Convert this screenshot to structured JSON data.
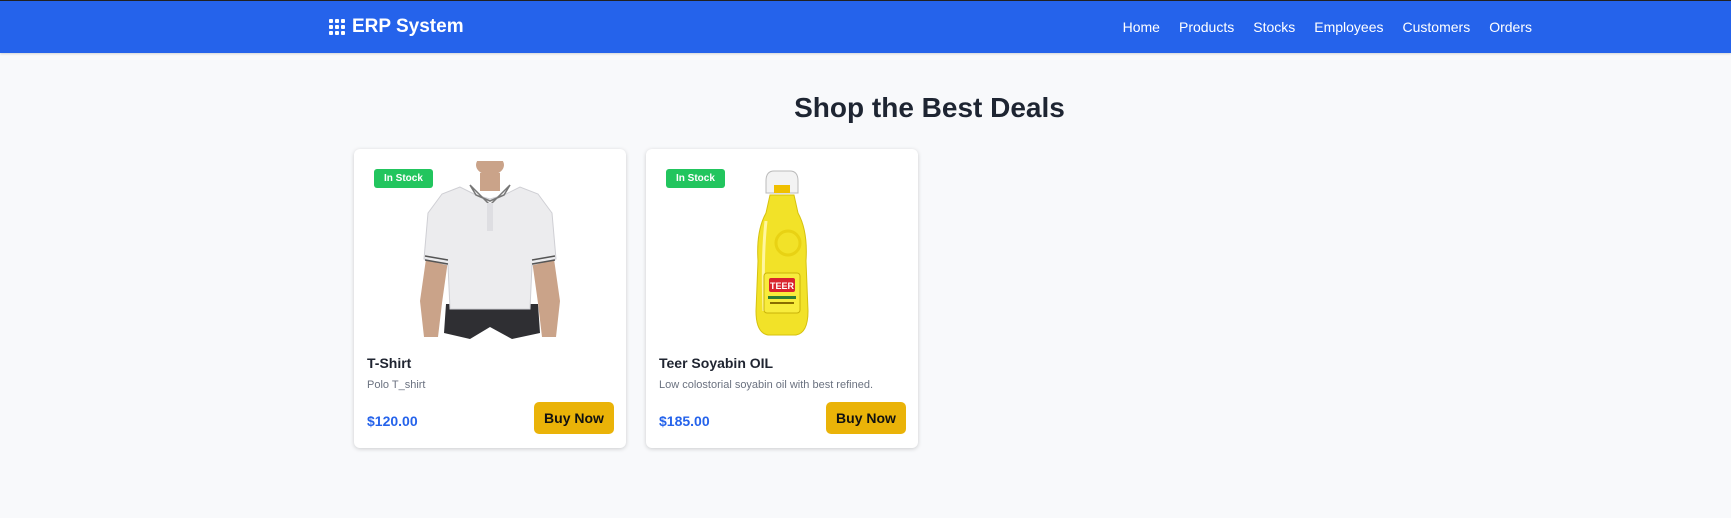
{
  "navbar": {
    "brand": "ERP System",
    "brand_icon": "grid-icon",
    "links": [
      "Home",
      "Products",
      "Stocks",
      "Employees",
      "Customers",
      "Orders"
    ],
    "color": "#2563eb"
  },
  "main": {
    "heading": "Shop the Best Deals",
    "products": [
      {
        "badge": "In Stock",
        "image": "polo-tshirt-image",
        "name": "T-Shirt",
        "description": "Polo T_shirt",
        "price": "$120.00",
        "button": "Buy Now"
      },
      {
        "badge": "In Stock",
        "image": "oil-bottle-image",
        "name": "Teer Soyabin OIL",
        "description": "Low colostorial soyabin oil with best refined.",
        "price": "$185.00",
        "button": "Buy Now"
      }
    ]
  },
  "colors": {
    "badge": "#22c55e",
    "button": "#eab308",
    "price": "#2563eb"
  }
}
